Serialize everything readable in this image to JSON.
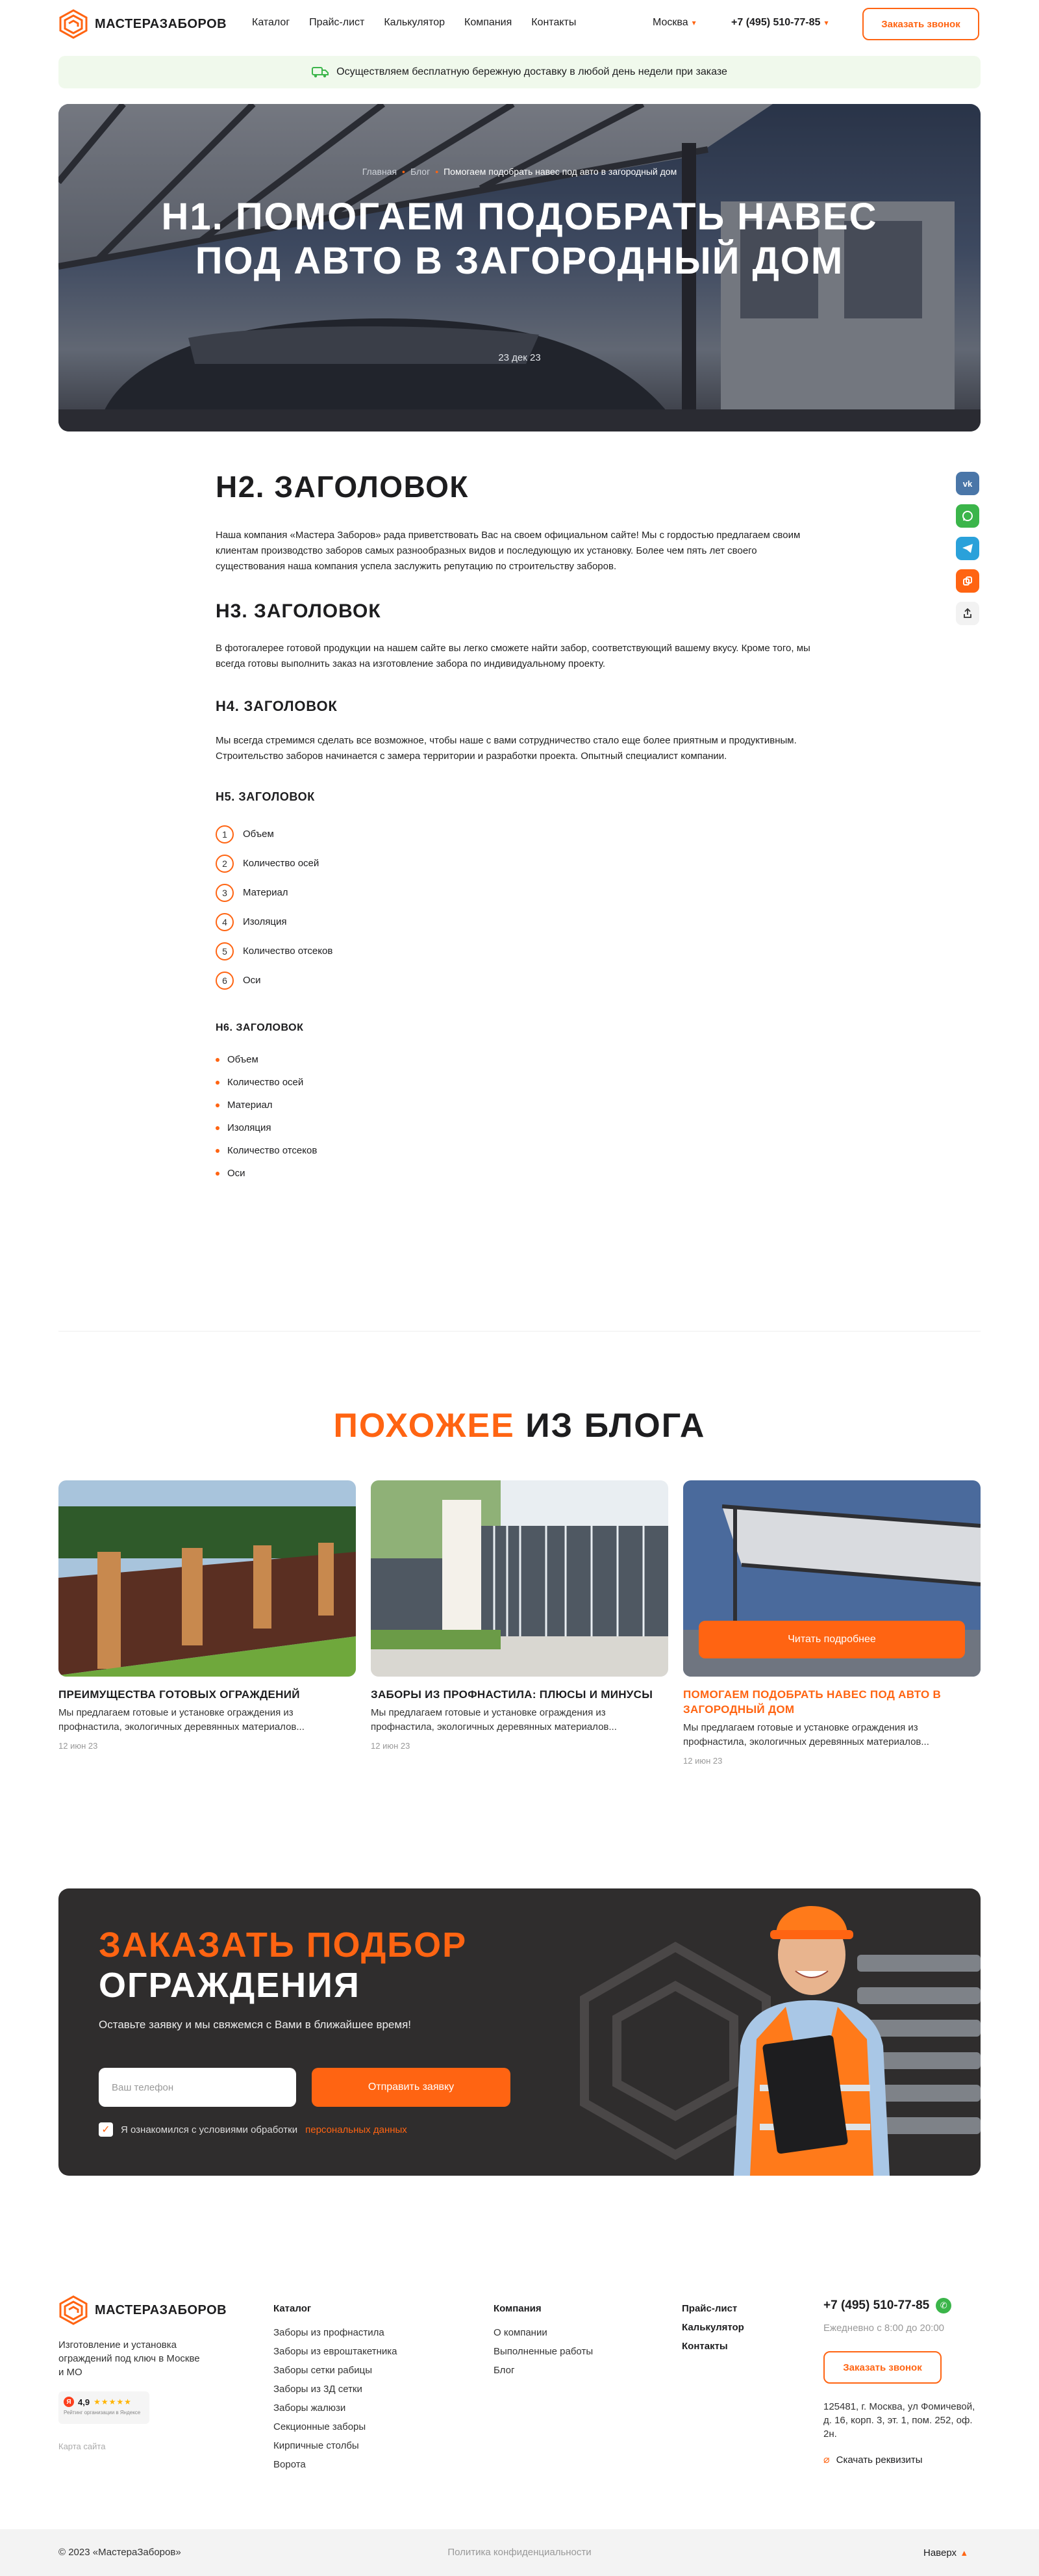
{
  "header": {
    "logo_text": "МАСТЕРАЗАБОРОВ",
    "nav": [
      "Каталог",
      "Прайс-лист",
      "Калькулятор",
      "Компания",
      "Контакты"
    ],
    "city": "Москва",
    "phone": "+7 (495) 510-77-85",
    "call_button": "Заказать звонок"
  },
  "delivery_banner": "Осуществляем бесплатную бережную доставку в любой день недели при заказе",
  "hero": {
    "breadcrumbs": [
      "Главная",
      "Блог",
      "Помогаем подобрать навес под авто в загородный дом"
    ],
    "title": "H1. ПОМОГАЕМ ПОДОБРАТЬ НАВЕС ПОД АВТО В ЗАГОРОДНЫЙ ДОМ",
    "date": "23 дек 23"
  },
  "social": [
    "vk",
    "whatsapp-icon",
    "telegram-icon",
    "copy-icon",
    "share-icon"
  ],
  "article": {
    "h2": "H2. ЗАГОЛОВОК",
    "p1": "Наша компания «Мастера Заборов» рада приветствовать Вас на своем официальном сайте! Мы с гордостью предлагаем своим клиентам производство заборов самых разнообразных видов и последующую их установку. Более чем пять лет своего существования наша компания успела заслужить репутацию по строительству заборов.",
    "h3": "H3. ЗАГОЛОВОК",
    "p2": "В фотогалерее готовой продукции на нашем сайте вы легко сможете найти забор, соответствующий вашему вкусу. Кроме того, мы всегда готовы выполнить заказ на изготовление забора по индивидуальному проекту.",
    "h4": "H4. ЗАГОЛОВОК",
    "p3": "Мы всегда стремимся сделать все возможное, чтобы наше с вами сотрудничество стало еще более приятным и продуктивным. Строительство заборов начинается с замера территории и разработки проекта. Опытный специалист компании.",
    "h5": "H5. ЗАГОЛОВОК",
    "ordered": [
      "Объем",
      "Количество осей",
      "Материал",
      "Изоляция",
      "Количество отсеков",
      "Оси"
    ],
    "h6": "H6. ЗАГОЛОВОК",
    "unordered": [
      "Объем",
      "Количество осей",
      "Материал",
      "Изоляция",
      "Количество отсеков",
      "Оси"
    ]
  },
  "blog": {
    "title_accent": "ПОХОЖЕЕ",
    "title_rest": "ИЗ БЛОГА",
    "cards": [
      {
        "title": "ПРЕИМУЩЕСТВА ГОТОВЫХ ОГРАЖДЕНИЙ",
        "text": "Мы предлагаем готовые и установке ограждения из профнастила, экологичных деревянных материалов...",
        "date": "12 июн 23"
      },
      {
        "title": "ЗАБОРЫ ИЗ ПРОФНАСТИЛА: ПЛЮСЫ И МИНУСЫ",
        "text": "Мы предлагаем готовые и установке ограждения из профнастила, экологичных деревянных материалов...",
        "date": "12 июн 23"
      },
      {
        "title": "ПОМОГАЕМ ПОДОБРАТЬ НАВЕС ПОД АВТО В ЗАГОРОДНЫЙ ДОМ",
        "text": "Мы предлагаем готовые и установке ограждения из профнастила, экологичных деревянных материалов...",
        "date": "12 июн 23",
        "button": "Читать подробнее"
      }
    ]
  },
  "order": {
    "title_accent": "ЗАКАЗАТЬ ПОДБОР",
    "title_rest": "ОГРАЖДЕНИЯ",
    "subtitle": "Оставьте заявку и мы свяжемся с Вами в ближайшее время!",
    "phone_placeholder": "Ваш телефон",
    "submit": "Отправить заявку",
    "agree_text": "Я ознакомился с условиями обработки",
    "agree_link": "персональных данных"
  },
  "footer": {
    "logo_text": "МАСТЕРАЗАБОРОВ",
    "description": "Изготовление и установка ограждений под ключ в Москве и МО",
    "rating_value": "4,9",
    "rating_caption": "Рейтинг организации в Яндексе",
    "sitemap": "Карта сайта",
    "catalog_heading": "Каталог",
    "catalog": [
      "Заборы из профнастила",
      "Заборы из евроштакетника",
      "Заборы сетки рабицы",
      "Заборы из 3Д сетки",
      "Заборы жалюзи",
      "Секционные заборы",
      "Кирпичные столбы",
      "Ворота"
    ],
    "company_heading": "Компания",
    "company": [
      "О компании",
      "Выполненные работы",
      "Блог"
    ],
    "links": [
      "Прайс-лист",
      "Калькулятор",
      "Контакты"
    ],
    "phone": "+7 (495) 510-77-85",
    "hours": "Ежедневно с 8:00 до 20:00",
    "call_button": "Заказать звонок",
    "address": "125481, г. Москва, ул Фомичевой, д. 16, корп. 3, эт. 1, пом. 252, оф. 2н.",
    "requisites": "Скачать реквизиты",
    "copyright": "© 2023 «МастераЗаборов»",
    "policy": "Политика конфиденциальности",
    "up": "Наверх"
  }
}
